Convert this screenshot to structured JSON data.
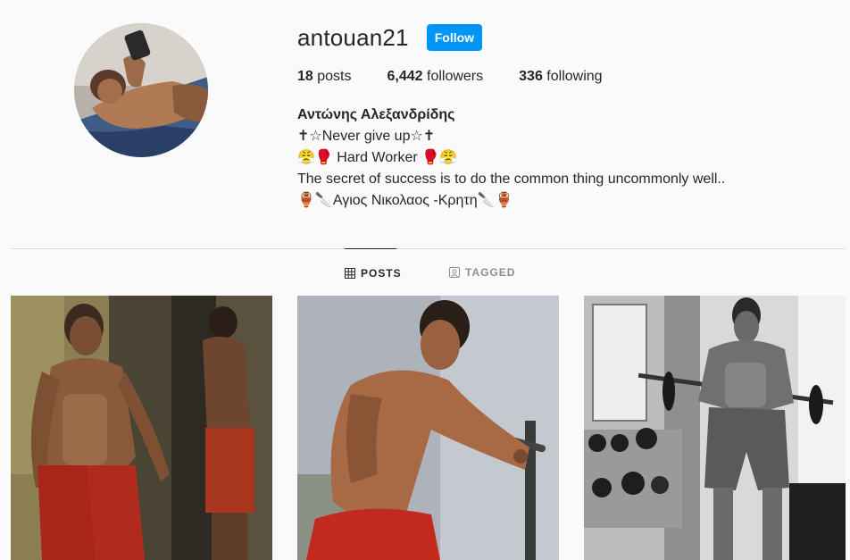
{
  "profile": {
    "username": "antouan21",
    "follow_label": "Follow",
    "stats": {
      "posts_count": "18",
      "posts_label": "posts",
      "followers_count": "6,442",
      "followers_label": "followers",
      "following_count": "336",
      "following_label": "following"
    },
    "bio": {
      "full_name": "Αντώνης Αλεξανδρίδης",
      "line1": "✝☆Never give up☆✝",
      "line2": "😤🥊 Hard Worker 🥊😤",
      "line3": "The secret of success is to do the common thing uncommonly well..",
      "line4": "🏺🔪Αγιος Νικολαος -Κρητη🔪🏺"
    }
  },
  "tabs": {
    "posts_label": "POSTS",
    "tagged_label": "TAGGED"
  },
  "icons": {
    "posts_tab": "grid-icon",
    "tagged_tab": "tagged-icon"
  },
  "colors": {
    "follow_button": "#0095f6",
    "background": "#fafafa",
    "divider": "#dbdbdb"
  }
}
